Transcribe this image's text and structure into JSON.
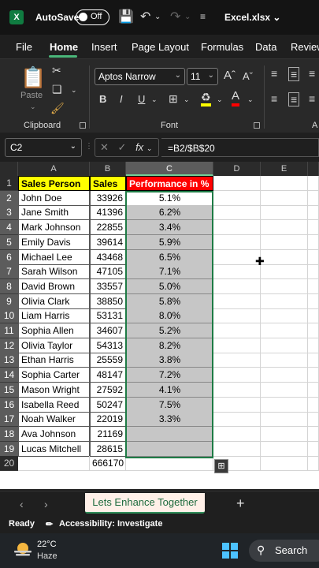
{
  "titlebar": {
    "app_logo": "X",
    "autosave_label": "AutoSave",
    "autosave_state": "Off",
    "filename": "Excel.xlsx",
    "icons": [
      "save-icon",
      "undo-icon",
      "redo-icon",
      "customize-icon"
    ]
  },
  "ribbon_tabs": [
    "File",
    "Home",
    "Insert",
    "Page Layout",
    "Formulas",
    "Data",
    "Review"
  ],
  "active_tab": "Home",
  "ribbon": {
    "clipboard_label": "Clipboard",
    "paste_label": "Paste",
    "font_label": "Font",
    "font_name": "Aptos Narrow",
    "font_size": "11",
    "bold": "B",
    "italic": "I",
    "underline": "U",
    "partial_label": "A"
  },
  "formula_bar": {
    "cell_ref": "C2",
    "formula": "=B2/$B$20"
  },
  "columns": [
    "A",
    "B",
    "C",
    "D",
    "E"
  ],
  "selected_column": "C",
  "headers": {
    "a": "Sales Person",
    "b": "Sales",
    "c": "Performance in %"
  },
  "rows": [
    {
      "name": "John Doe",
      "sales": "33926",
      "perf": "5.1%"
    },
    {
      "name": "Jane Smith",
      "sales": "41396",
      "perf": "6.2%"
    },
    {
      "name": "Mark Johnson",
      "sales": "22855",
      "perf": "3.4%"
    },
    {
      "name": "Emily Davis",
      "sales": "39614",
      "perf": "5.9%"
    },
    {
      "name": "Michael Lee",
      "sales": "43468",
      "perf": "6.5%"
    },
    {
      "name": "Sarah Wilson",
      "sales": "47105",
      "perf": "7.1%"
    },
    {
      "name": "David Brown",
      "sales": "33557",
      "perf": "5.0%"
    },
    {
      "name": "Olivia Clark",
      "sales": "38850",
      "perf": "5.8%"
    },
    {
      "name": "Liam Harris",
      "sales": "53131",
      "perf": "8.0%"
    },
    {
      "name": "Sophia Allen",
      "sales": "34607",
      "perf": "5.2%"
    },
    {
      "name": "Olivia Taylor",
      "sales": "54313",
      "perf": "8.2%"
    },
    {
      "name": "Ethan Harris",
      "sales": "25559",
      "perf": "3.8%"
    },
    {
      "name": "Sophia Carter",
      "sales": "48147",
      "perf": "7.2%"
    },
    {
      "name": "Mason Wright",
      "sales": "27592",
      "perf": "4.1%"
    },
    {
      "name": "Isabella Reed",
      "sales": "50247",
      "perf": "7.5%"
    },
    {
      "name": "Noah Walker",
      "sales": "22019",
      "perf": "3.3%"
    },
    {
      "name": "Ava Johnson",
      "sales": "21169",
      "perf": ""
    },
    {
      "name": "Lucas Mitchell",
      "sales": "28615",
      "perf": ""
    }
  ],
  "total": "666170",
  "row_numbers": [
    "1",
    "2",
    "3",
    "4",
    "5",
    "6",
    "7",
    "8",
    "9",
    "10",
    "11",
    "12",
    "13",
    "14",
    "15",
    "16",
    "17",
    "18",
    "19",
    "20"
  ],
  "sheet_tab": "Lets Enhance Together",
  "status": {
    "ready": "Ready",
    "accessibility": "Accessibility: Investigate"
  },
  "taskbar": {
    "temperature": "22°C",
    "condition": "Haze",
    "search_label": "Search"
  },
  "colors": {
    "accent_green": "#107c41",
    "header_yellow": "#ffff00",
    "header_red": "#ff0000",
    "selection_gray": "#c6c6c6"
  }
}
